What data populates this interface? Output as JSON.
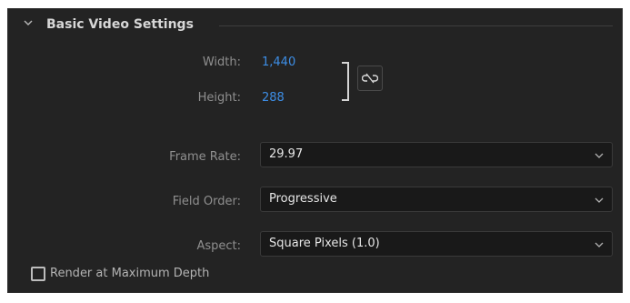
{
  "section": {
    "title": "Basic Video Settings"
  },
  "dimensions": {
    "width_label": "Width:",
    "width_value": "1,440",
    "height_label": "Height:",
    "height_value": "288",
    "link_icon": "unlink-icon"
  },
  "frame_rate": {
    "label": "Frame Rate:",
    "value": "29.97"
  },
  "field_order": {
    "label": "Field Order:",
    "value": "Progressive"
  },
  "aspect": {
    "label": "Aspect:",
    "value": "Square Pixels (1.0)"
  },
  "render_max_depth": {
    "label": "Render at Maximum Depth",
    "checked": false
  },
  "colors": {
    "panel_bg": "#232323",
    "value_blue": "#3d8ee6",
    "label_gray": "#8f8f8f"
  }
}
